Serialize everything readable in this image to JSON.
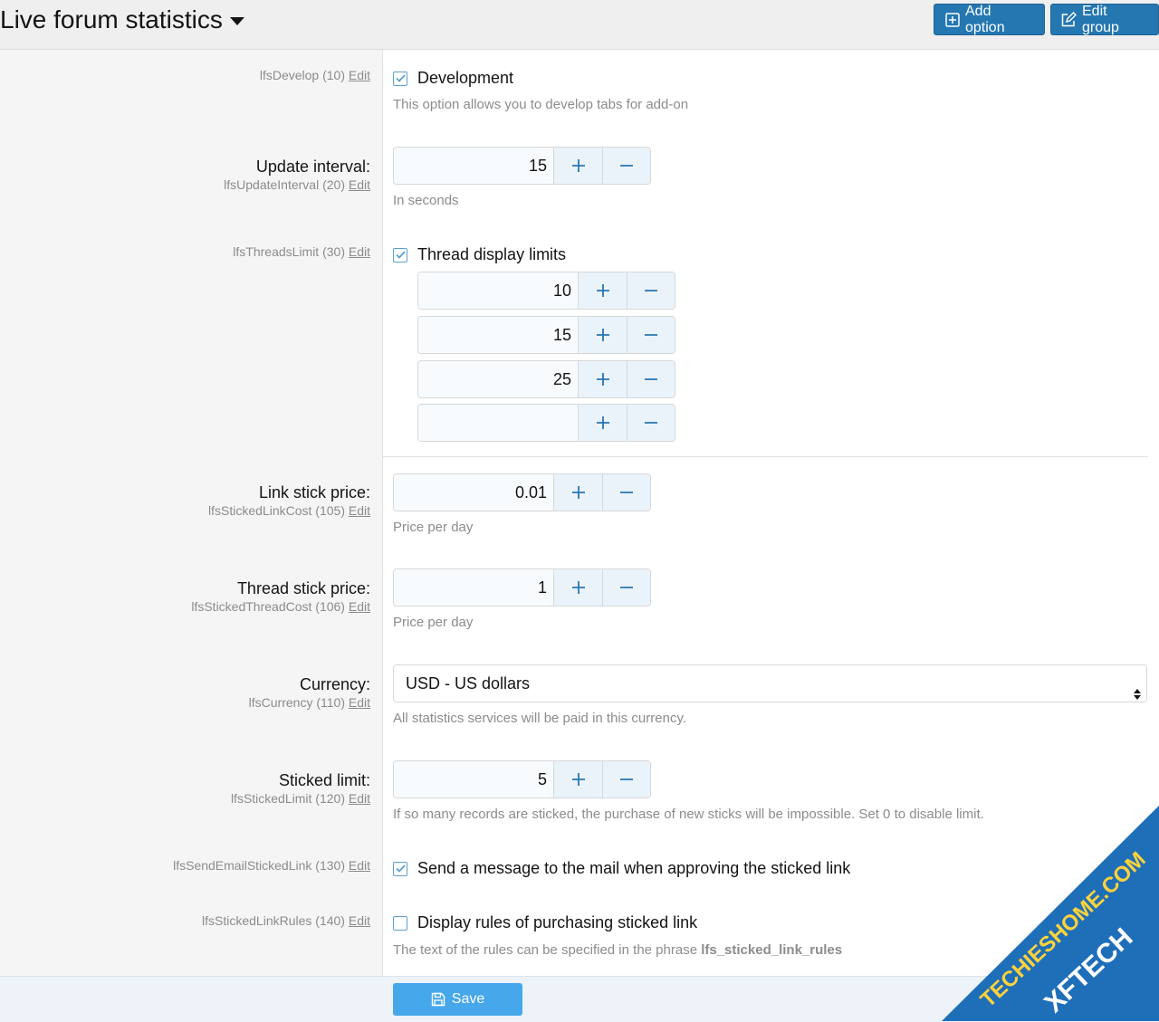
{
  "header": {
    "title": "Live forum statistics",
    "add_option_label": "Add option",
    "edit_group_label": "Edit group"
  },
  "edit_label": "Edit",
  "options": {
    "develop": {
      "key": "lfsDevelop (10)",
      "label": "Development",
      "checked": true,
      "explain": "This option allows you to develop tabs for add-on"
    },
    "update_interval": {
      "label": "Update interval:",
      "key": "lfsUpdateInterval (20)",
      "value": "15",
      "explain": "In seconds"
    },
    "threads_limit": {
      "key": "lfsThreadsLimit (30)",
      "label": "Thread display limits",
      "checked": true,
      "values": [
        "10",
        "15",
        "25",
        ""
      ]
    },
    "link_stick_price": {
      "label": "Link stick price:",
      "key": "lfsStickedLinkCost (105)",
      "value": "0.01",
      "explain": "Price per day"
    },
    "thread_stick_price": {
      "label": "Thread stick price:",
      "key": "lfsStickedThreadCost (106)",
      "value": "1",
      "explain": "Price per day"
    },
    "currency": {
      "label": "Currency:",
      "key": "lfsCurrency (110)",
      "selected": "USD - US dollars",
      "explain": "All statistics services will be paid in this currency."
    },
    "sticked_limit": {
      "label": "Sticked limit:",
      "key": "lfsStickedLimit (120)",
      "value": "5",
      "explain": "If so many records are sticked, the purchase of new sticks will be impossible. Set 0 to disable limit."
    },
    "send_email": {
      "key": "lfsSendEmailStickedLink (130)",
      "label": "Send a message to the mail when approving the sticked link",
      "checked": true
    },
    "sticked_rules": {
      "key": "lfsStickedLinkRules (140)",
      "label": "Display rules of purchasing sticked link",
      "checked": false,
      "explain_prefix": "The text of the rules can be specified in the phrase ",
      "explain_phrase": "lfs_sticked_link_rules"
    }
  },
  "footer": {
    "save_label": "Save"
  },
  "watermark": {
    "line1": "TECHIESHOME.COM",
    "line2": "XFTECH"
  },
  "colors": {
    "accent": "#2577b1",
    "save": "#47a7eb",
    "check": "#5aa1d2"
  }
}
